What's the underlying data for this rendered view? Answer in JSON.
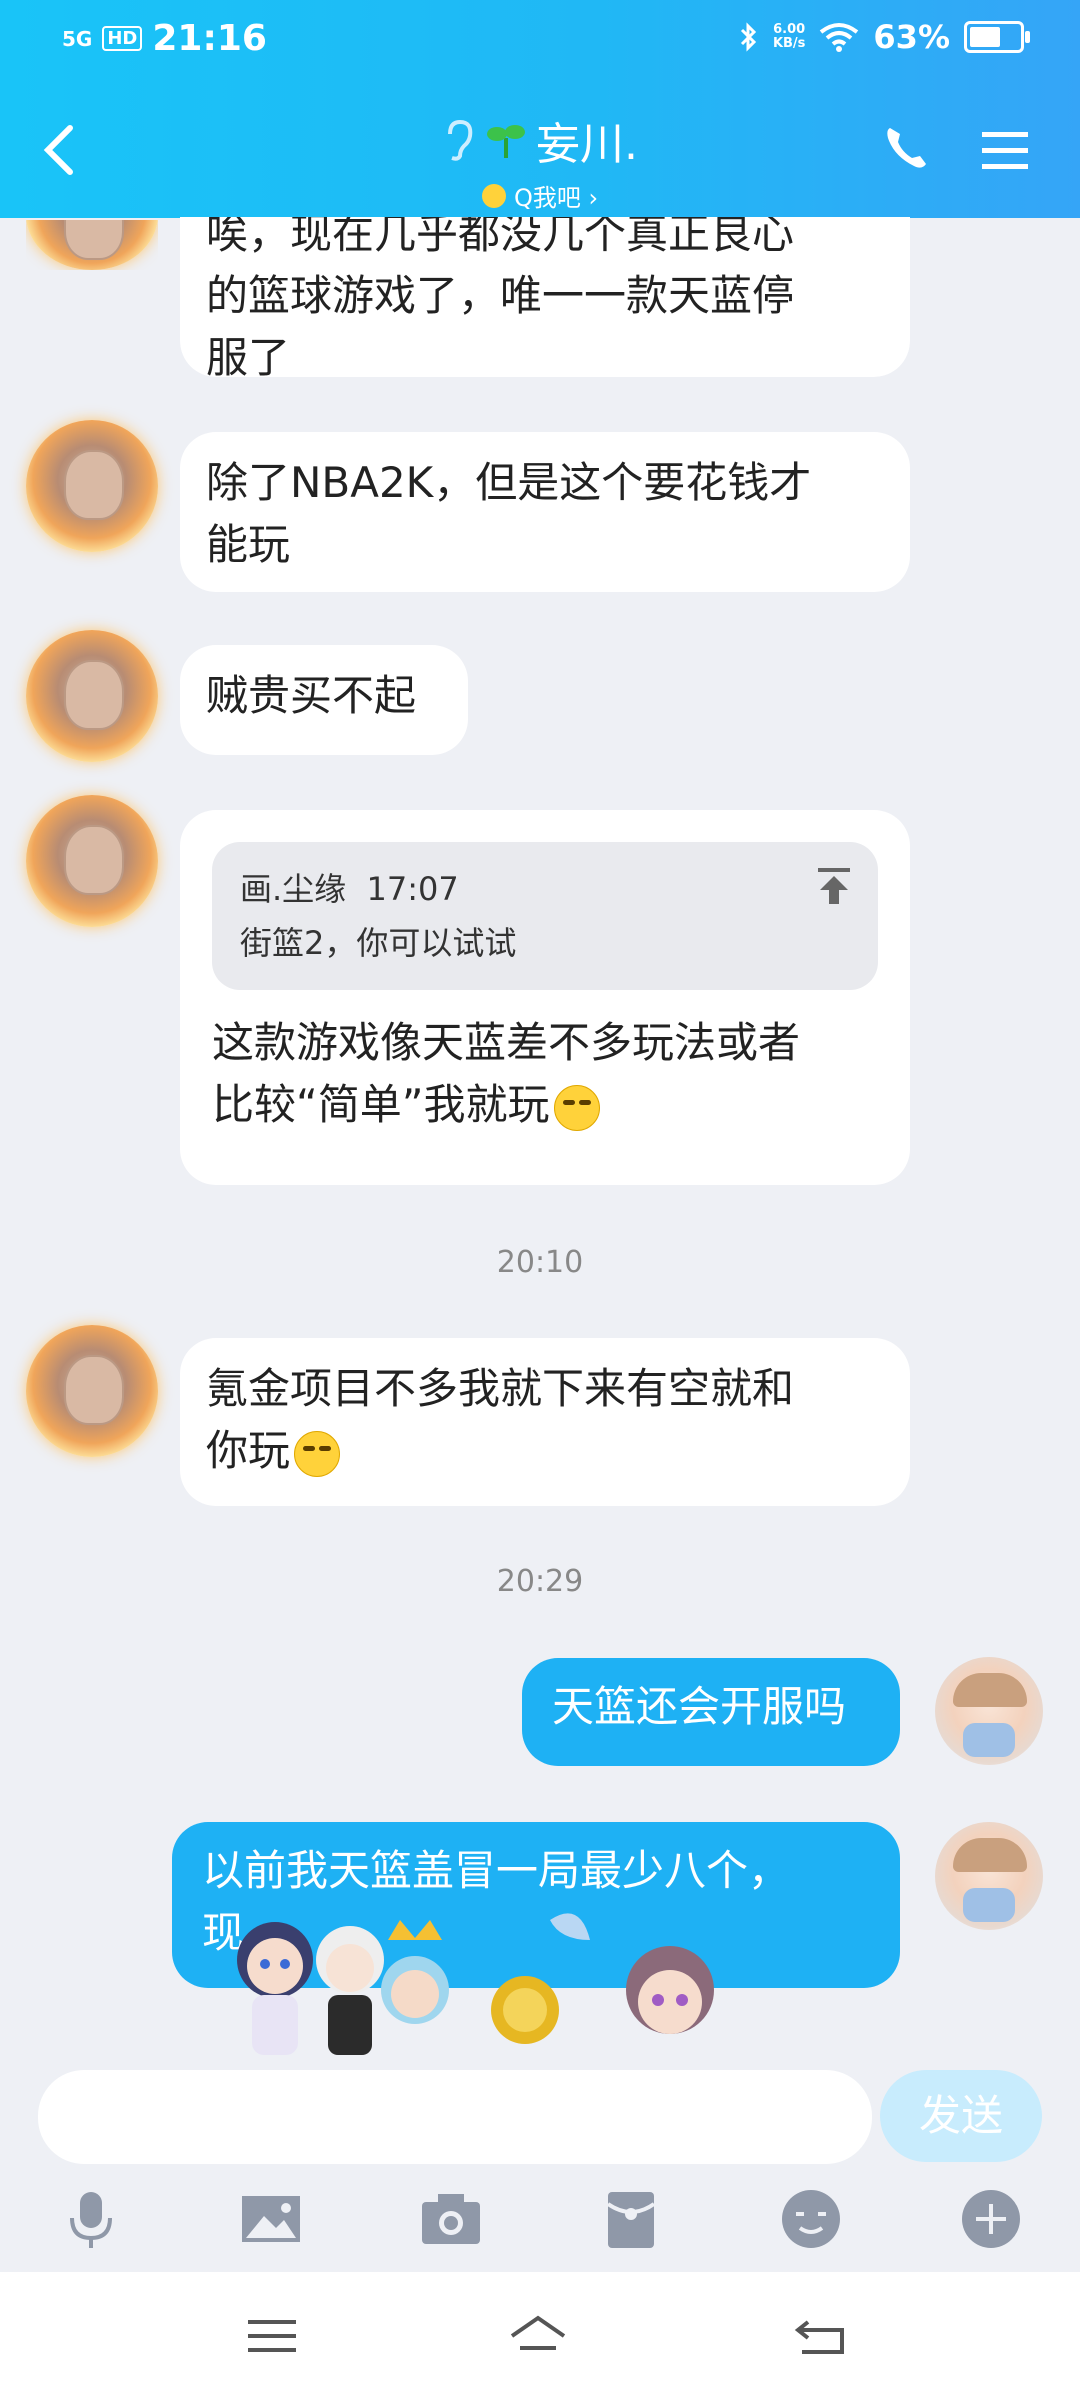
{
  "status_bar": {
    "network": "5G",
    "hd_label": "HD",
    "time": "21:16",
    "speed_value": "6.00",
    "speed_unit": "KB/s",
    "battery": "63%",
    "battery_level": 0.63
  },
  "header": {
    "contact_name": "妄川.",
    "sub_link": "Q我吧 ›"
  },
  "messages": [
    {
      "side": "in",
      "text_lines": [
        "唉，现在几乎都没几个真正良心",
        "的篮球游戏了，唯一一款天蓝停",
        "服了"
      ]
    },
    {
      "side": "in",
      "text_lines": [
        "除了NBA2K，但是这个要花钱才",
        "能玩"
      ]
    },
    {
      "side": "in",
      "text_lines": [
        "贼贵买不起"
      ]
    },
    {
      "side": "in",
      "quote_author": "画.尘缘",
      "quote_time": "17:07",
      "quote_text": "街篮2，你可以试试",
      "text_lines": [
        "这款游戏像天蓝差不多玩法或者",
        "比较“简单”我就玩"
      ]
    },
    {
      "time": "20:10"
    },
    {
      "side": "in",
      "text_lines": [
        "氪金项目不多我就下来有空就和",
        "你玩"
      ]
    },
    {
      "time": "20:29"
    },
    {
      "side": "out",
      "text_lines": [
        "天篮还会开服吗"
      ]
    },
    {
      "side": "out",
      "text_lines": [
        "以前我天篮盖冒一局最少八个，",
        "现"
      ]
    }
  ],
  "input": {
    "placeholder": "",
    "send_label": "发送"
  },
  "colors": {
    "header_start": "#19c4f8",
    "header_end": "#35a5f7",
    "outgoing_bubble": "#1eb1f4",
    "send_disabled": "#c8ecfd",
    "tool_icon": "#8f98a8"
  },
  "tools": [
    "microphone-icon",
    "image-icon",
    "camera-icon",
    "red-packet-icon",
    "emoji-icon",
    "plus-icon"
  ]
}
